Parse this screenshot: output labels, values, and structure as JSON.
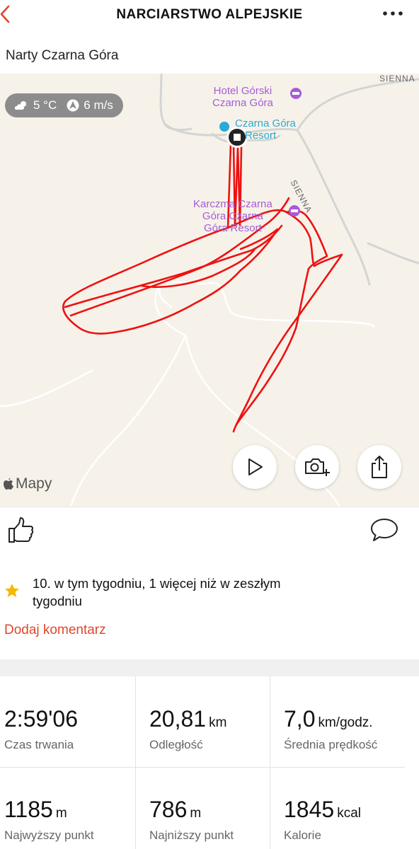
{
  "header": {
    "title": "NARCIARSTWO ALPEJSKIE",
    "back_icon": "chevron-left-icon",
    "more_icon": "more-horizontal-icon",
    "accent_color": "#e0472b"
  },
  "activity": {
    "name": "Narty Czarna Góra"
  },
  "map": {
    "weather": {
      "temperature": "5 °C",
      "wind": "6 m/s"
    },
    "labels": {
      "hotel_line1": "Hotel Górski",
      "hotel_line2": "Czarna Góra",
      "resort_line1": "Czarna Góra",
      "resort_line2": "Resort",
      "karczma_line1": "Karczma Czarna",
      "karczma_line2": "Góra Czarna",
      "karczma_line3": "Góra Resort",
      "road_sienna_top": "SIENNA",
      "road_sienna": "SIENNA"
    },
    "attribution": "Mapy",
    "buttons": [
      "play-icon",
      "camera-add-icon",
      "share-icon"
    ],
    "track_color": "#ee1111"
  },
  "actions": {
    "like_icon": "thumbs-up-icon",
    "comment_icon": "comment-icon"
  },
  "achievement": {
    "text": "10. w tym tygodniu, 1 więcej niż w zeszłym tygodniu",
    "star_color": "#f5b800"
  },
  "add_comment": "Dodaj komentarz",
  "stats": [
    {
      "value": "2:59'06",
      "unit": "",
      "label": "Czas trwania"
    },
    {
      "value": "20,81",
      "unit": "km",
      "label": "Odległość"
    },
    {
      "value": "7,0",
      "unit": "km/godz.",
      "label": "Średnia prędkość"
    },
    {
      "value": "1185",
      "unit": "m",
      "label": "Najwyższy punkt"
    },
    {
      "value": "786",
      "unit": "m",
      "label": "Najniższy punkt"
    },
    {
      "value": "1845",
      "unit": "kcal",
      "label": "Kalorie"
    }
  ]
}
